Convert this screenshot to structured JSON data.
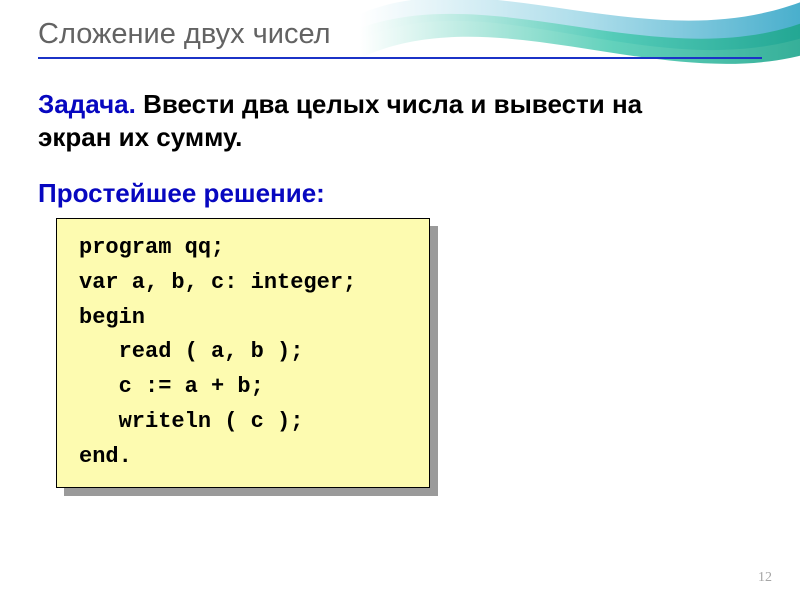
{
  "title": "Сложение двух чисел",
  "task": {
    "label": "Задача.",
    "text_line1": " Ввести два целых числа и вывести на",
    "text_line2": "экран их сумму."
  },
  "solution_label": "Простейшее решение:",
  "code": "program qq;\nvar a, b, c: integer;\nbegin\n   read ( a, b );\n   c := a + b;\n   writeln ( c );\nend.",
  "page_number": "12"
}
